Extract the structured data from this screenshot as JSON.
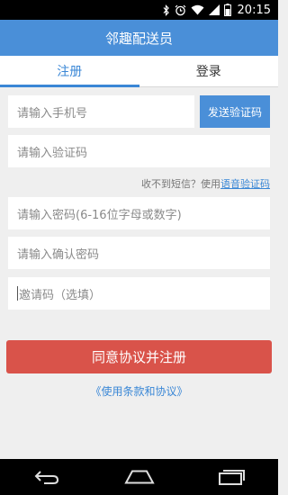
{
  "status_bar": {
    "time": "20:15",
    "icons": [
      "bluetooth-icon",
      "alarm-icon",
      "wifi-icon",
      "signal-icon",
      "battery-icon"
    ]
  },
  "app_bar": {
    "title": "邻趣配送员"
  },
  "tabs": [
    {
      "label": "注册",
      "active": true
    },
    {
      "label": "登录",
      "active": false
    }
  ],
  "form": {
    "phone_placeholder": "请输入手机号",
    "send_code_label": "发送验证码",
    "code_placeholder": "请输入验证码",
    "sms_hint": "收不到短信？使用",
    "voice_code_link": "语音验证码",
    "password_placeholder": "请输入密码(6-16位字母或数字)",
    "confirm_password_placeholder": "请输入确认密码",
    "invite_placeholder": "邀请码（选填）",
    "submit_label": "同意协议并注册",
    "terms_link": "《使用条款和协议》"
  },
  "nav_bar": {
    "buttons": [
      "back-icon",
      "home-icon",
      "recent-apps-icon"
    ]
  },
  "colors": {
    "primary": "#4a8fd8",
    "submit": "#d9534a",
    "link": "#3a87d6"
  }
}
